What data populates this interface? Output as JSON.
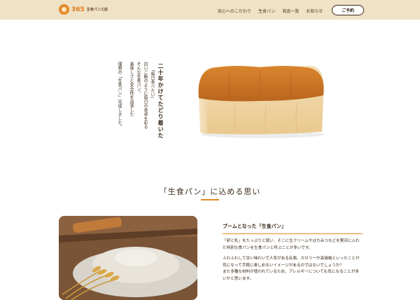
{
  "brand": {
    "number": "365",
    "name": "生食パン工房"
  },
  "nav": {
    "items": [
      "安心へのこだわり",
      "生食パン",
      "商品一覧",
      "お知らせ"
    ],
    "reserve_label": "ご予約"
  },
  "hero": {
    "heading": "二十年かけてたどり着いた",
    "lines": [
      "「毎日食べたい」",
      "白いご飯のように毎日の食卓を彩る",
      "そんな生食パン。",
      "美味しさと安全性を追求した",
      "理想の「生食パン」完成しました。"
    ]
  },
  "section": {
    "title": "「生食パン」に込める思い"
  },
  "article": {
    "heading": "ブームとなった「生食パン」",
    "paragraphs": [
      "「卵と乳」をたっぷりと使い、そこに生クリームやはちみつなどを贅沢に入れた特別な食パンを生食パンと呼ぶことが多いです。",
      "ふわふわして甘い味わいで人気がある反面、カロリーや高価格といったことが気になって手軽に楽しめないイメージがあるのではないでしょうか？",
      "また多種な材料が使われているため、アレルギーについても気になることが多いかと思います。"
    ]
  },
  "colors": {
    "header_bg": "#f0e2c5",
    "accent": "#e28a2a"
  },
  "icons": {
    "logo": "bread-face-logo-icon"
  }
}
